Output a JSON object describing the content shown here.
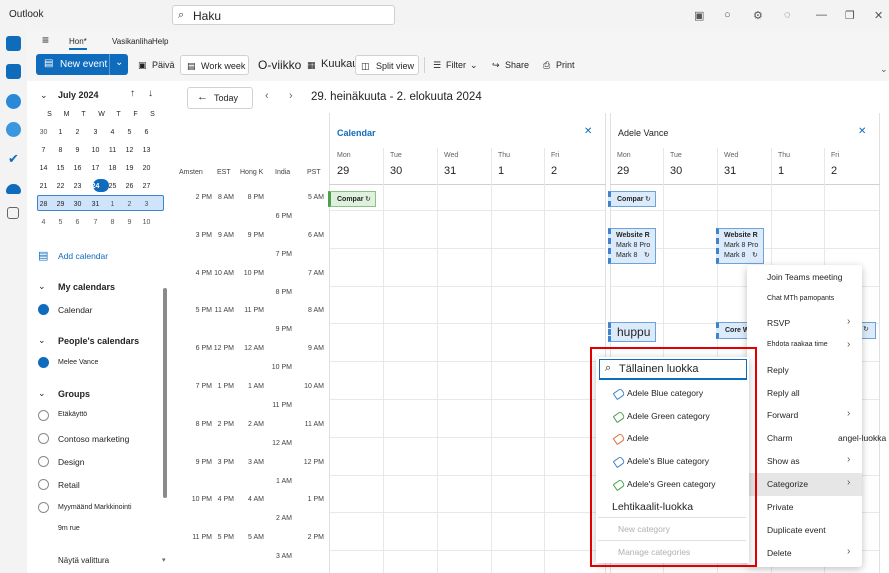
{
  "app": {
    "title": "Outlook"
  },
  "search": {
    "placeholder": "Haku"
  },
  "ribbon": {
    "tabs": [
      "Hon*",
      "Vasikanliha",
      "Help"
    ],
    "new_event": "New event",
    "day": "Päivä",
    "work_week": "Work week",
    "week": "O-viikko",
    "month": "Kuukausi",
    "split_view": "Split view",
    "filter": "Filter",
    "share": "Share",
    "print": "Print"
  },
  "nav": {
    "today": "Today",
    "range": "29. heinäkuuta - 2. elokuuta 2024"
  },
  "mini_cal": {
    "month": "July 2024",
    "weekdays": [
      "S",
      "M",
      "T",
      "W",
      "T",
      "F",
      "S"
    ],
    "weeks": [
      [
        "30",
        "1",
        "2",
        "3",
        "4",
        "5",
        "6"
      ],
      [
        "7",
        "8",
        "9",
        "10",
        "11",
        "12",
        "13"
      ],
      [
        "14",
        "15",
        "16",
        "17",
        "18",
        "19",
        "20"
      ],
      [
        "21",
        "22",
        "23",
        "24",
        "25",
        "26",
        "27"
      ],
      [
        "28",
        "29",
        "30",
        "31",
        "1",
        "2",
        "3"
      ],
      [
        "4",
        "5",
        "6",
        "7",
        "8",
        "9",
        "10"
      ]
    ]
  },
  "sidebar": {
    "add_calendar": "Add calendar",
    "my_calendars": "My calendars",
    "calendar": "Calendar",
    "peoples_calendars": "People's calendars",
    "person": "Melee Vance",
    "groups": "Groups",
    "group_items": [
      "Etäkäyttö",
      "Contoso marketing",
      "Design",
      "Retail",
      "Myymäänd Markkinointi"
    ],
    "extra": "9m rue",
    "show_all": "Näytä valittura"
  },
  "timezones": [
    "Amsten",
    "EST",
    "Hong K",
    "India",
    "PST"
  ],
  "tz_rows": [
    [
      "2 PM",
      "8 AM",
      "8 PM",
      "",
      "5 AM"
    ],
    [
      "",
      "",
      "",
      "6 PM",
      ""
    ],
    [
      "3 PM",
      "9 AM",
      "9 PM",
      "",
      "6 AM"
    ],
    [
      "",
      "",
      "",
      "7 PM",
      ""
    ],
    [
      "4 PM",
      "10 AM",
      "10 PM",
      "",
      "7 AM"
    ],
    [
      "",
      "",
      "",
      "8 PM",
      ""
    ],
    [
      "5 PM",
      "11 AM",
      "11 PM",
      "",
      "8 AM"
    ],
    [
      "",
      "",
      "",
      "9 PM",
      ""
    ],
    [
      "6 PM",
      "12 PM",
      "12 AM",
      "",
      "9 AM"
    ],
    [
      "",
      "",
      "",
      "10 PM",
      ""
    ],
    [
      "7 PM",
      "1 PM",
      "1 AM",
      "",
      "10 AM"
    ],
    [
      "",
      "",
      "",
      "11 PM",
      ""
    ],
    [
      "8 PM",
      "2 PM",
      "2 AM",
      "",
      "11 AM"
    ],
    [
      "",
      "",
      "",
      "12 AM",
      ""
    ],
    [
      "9 PM",
      "3 PM",
      "3 AM",
      "",
      "12 PM"
    ],
    [
      "",
      "",
      "",
      "1 AM",
      ""
    ],
    [
      "10 PM",
      "4 PM",
      "4 AM",
      "",
      "1 PM"
    ],
    [
      "",
      "",
      "",
      "2 AM",
      ""
    ],
    [
      "11 PM",
      "5 PM",
      "5 AM",
      "",
      "2 PM"
    ],
    [
      "",
      "",
      "",
      "3 AM",
      ""
    ]
  ],
  "panes": [
    {
      "title": "Calendar",
      "days": [
        [
          "Mon",
          "29"
        ],
        [
          "Tue",
          "30"
        ],
        [
          "Wed",
          "31"
        ],
        [
          "Thu",
          "1"
        ],
        [
          "Fri",
          "2"
        ]
      ]
    },
    {
      "title": "Adele Vance",
      "days": [
        [
          "Mon",
          "29"
        ],
        [
          "Tue",
          "30"
        ],
        [
          "Wed",
          "31"
        ],
        [
          "Thu",
          "1"
        ],
        [
          "Fri",
          "2"
        ]
      ]
    }
  ],
  "events": {
    "compar": "Compar",
    "website_r": "Website R",
    "mark8pro": "Mark 8 Pro",
    "mark8": "Mark 8",
    "huppu": "huppu",
    "core": "Core W"
  },
  "context_menu": [
    "Join Teams meeting",
    "Chat MTh pamopants",
    "RSVP",
    "Ehdota raakaa time",
    "Reply",
    "Reply all",
    "Forward",
    "Charm",
    "Show as",
    "Categorize",
    "Private",
    "Duplicate event",
    "Delete"
  ],
  "charm_extra": "angel-luokka",
  "categories": {
    "search": "Tällainen luokka",
    "items": [
      "Adele Blue category",
      "Adele Green category",
      "Adele",
      "Adele's Blue category",
      "Adele's Green category"
    ],
    "colors": [
      "#3f83cf",
      "#4ba04c",
      "#e0703a",
      "#3f83cf",
      "#4ba04c"
    ],
    "all": "Lehtikaalit-luokka",
    "new": "New category",
    "manage": "Manage categories"
  }
}
